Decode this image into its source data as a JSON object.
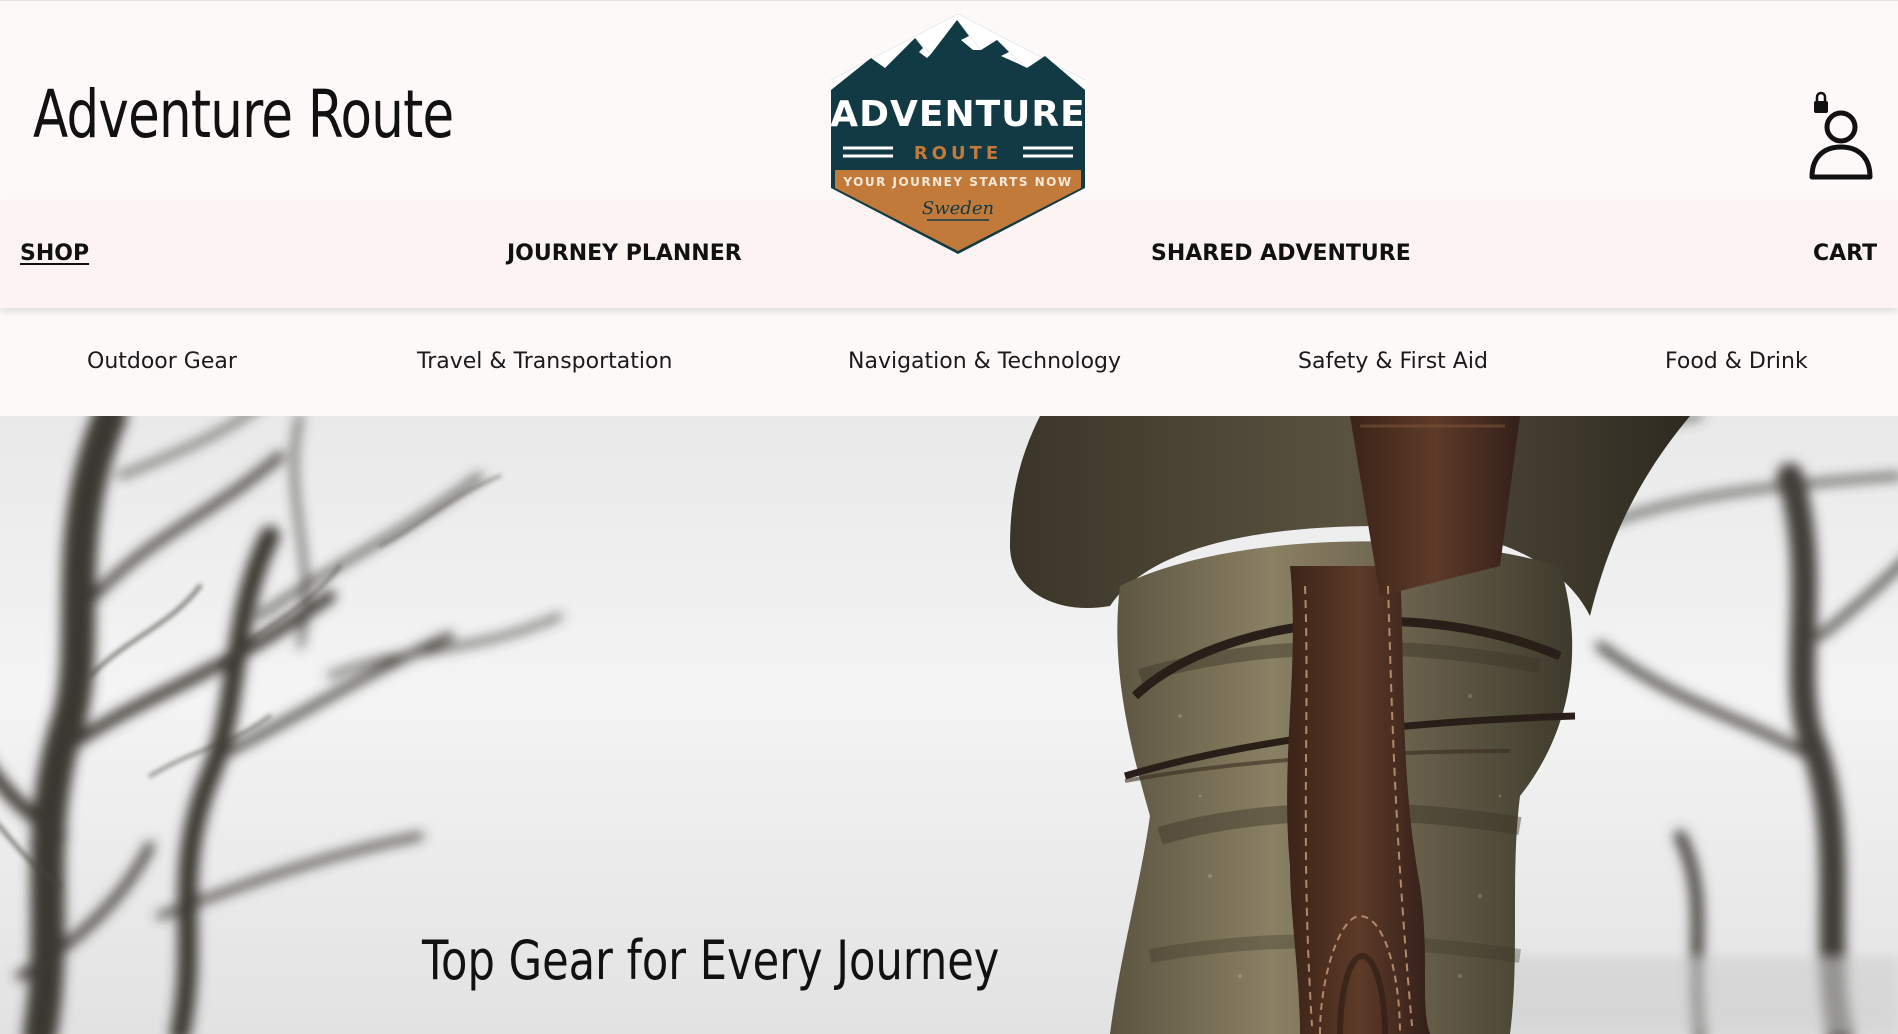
{
  "header": {
    "site_title": "Adventure Route",
    "account_icon": "account-icon"
  },
  "logo": {
    "lettering": [
      "ADVENTURE",
      "ROUTE",
      "YOUR JOURNEY STARTS NOW",
      "Sweden"
    ],
    "colors": {
      "navy": "#123a44",
      "copper": "#c17a3a",
      "cream": "#f4e9d8"
    }
  },
  "nav": {
    "items": [
      {
        "label": "SHOP",
        "active": true
      },
      {
        "label": "JOURNEY PLANNER",
        "active": false
      },
      {
        "label": "SHARED ADVENTURE",
        "active": false
      },
      {
        "label": "CART",
        "active": false
      }
    ]
  },
  "subnav": {
    "items": [
      {
        "label": "Outdoor Gear"
      },
      {
        "label": "Travel & Transportation"
      },
      {
        "label": "Navigation & Technology"
      },
      {
        "label": "Safety & First Aid"
      },
      {
        "label": "Food & Drink"
      }
    ]
  },
  "hero": {
    "caption": "Top Gear for Every Journey"
  }
}
